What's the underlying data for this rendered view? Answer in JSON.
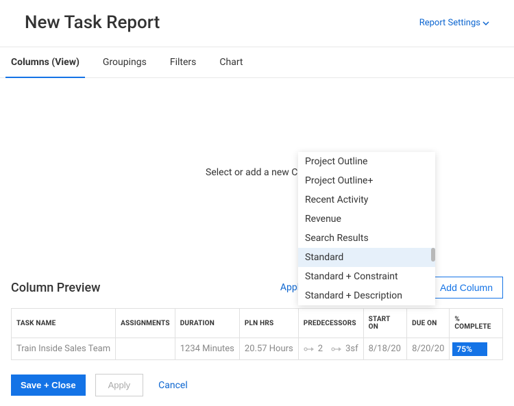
{
  "header": {
    "title": "New Task Report",
    "report_settings": "Report Settings"
  },
  "tabs": {
    "columns": "Columns (View)",
    "groupings": "Groupings",
    "filters": "Filters",
    "chart": "Chart"
  },
  "middle": {
    "select_label": "Select or add a new Column"
  },
  "dropdown": {
    "items": [
      "Project Outline",
      "Project Outline+",
      "Recent Activity",
      "Revenue",
      "Search Results",
      "Standard",
      "Standard + Constraint",
      "Standard + Description"
    ],
    "highlighted_index": 5
  },
  "preview": {
    "title": "Column Preview",
    "apply_view": "Apply an Existing View",
    "add_column": "Add Column"
  },
  "table": {
    "headers": [
      "TASK NAME",
      "ASSIGNMENTS",
      "DURATION",
      "PLN HRS",
      "PREDECESSORS",
      "START ON",
      "DUE ON",
      "% COMPLETE"
    ],
    "row": {
      "task_name": "Train Inside Sales Team",
      "assignments": "",
      "duration": "1234 Minutes",
      "pln_hrs": "20.57 Hours",
      "pred1": "2",
      "pred2": "3sf",
      "start_on": "8/18/20",
      "due_on": "8/20/20",
      "percent": "75%"
    }
  },
  "footer": {
    "save_close": "Save + Close",
    "apply": "Apply",
    "cancel": "Cancel"
  }
}
